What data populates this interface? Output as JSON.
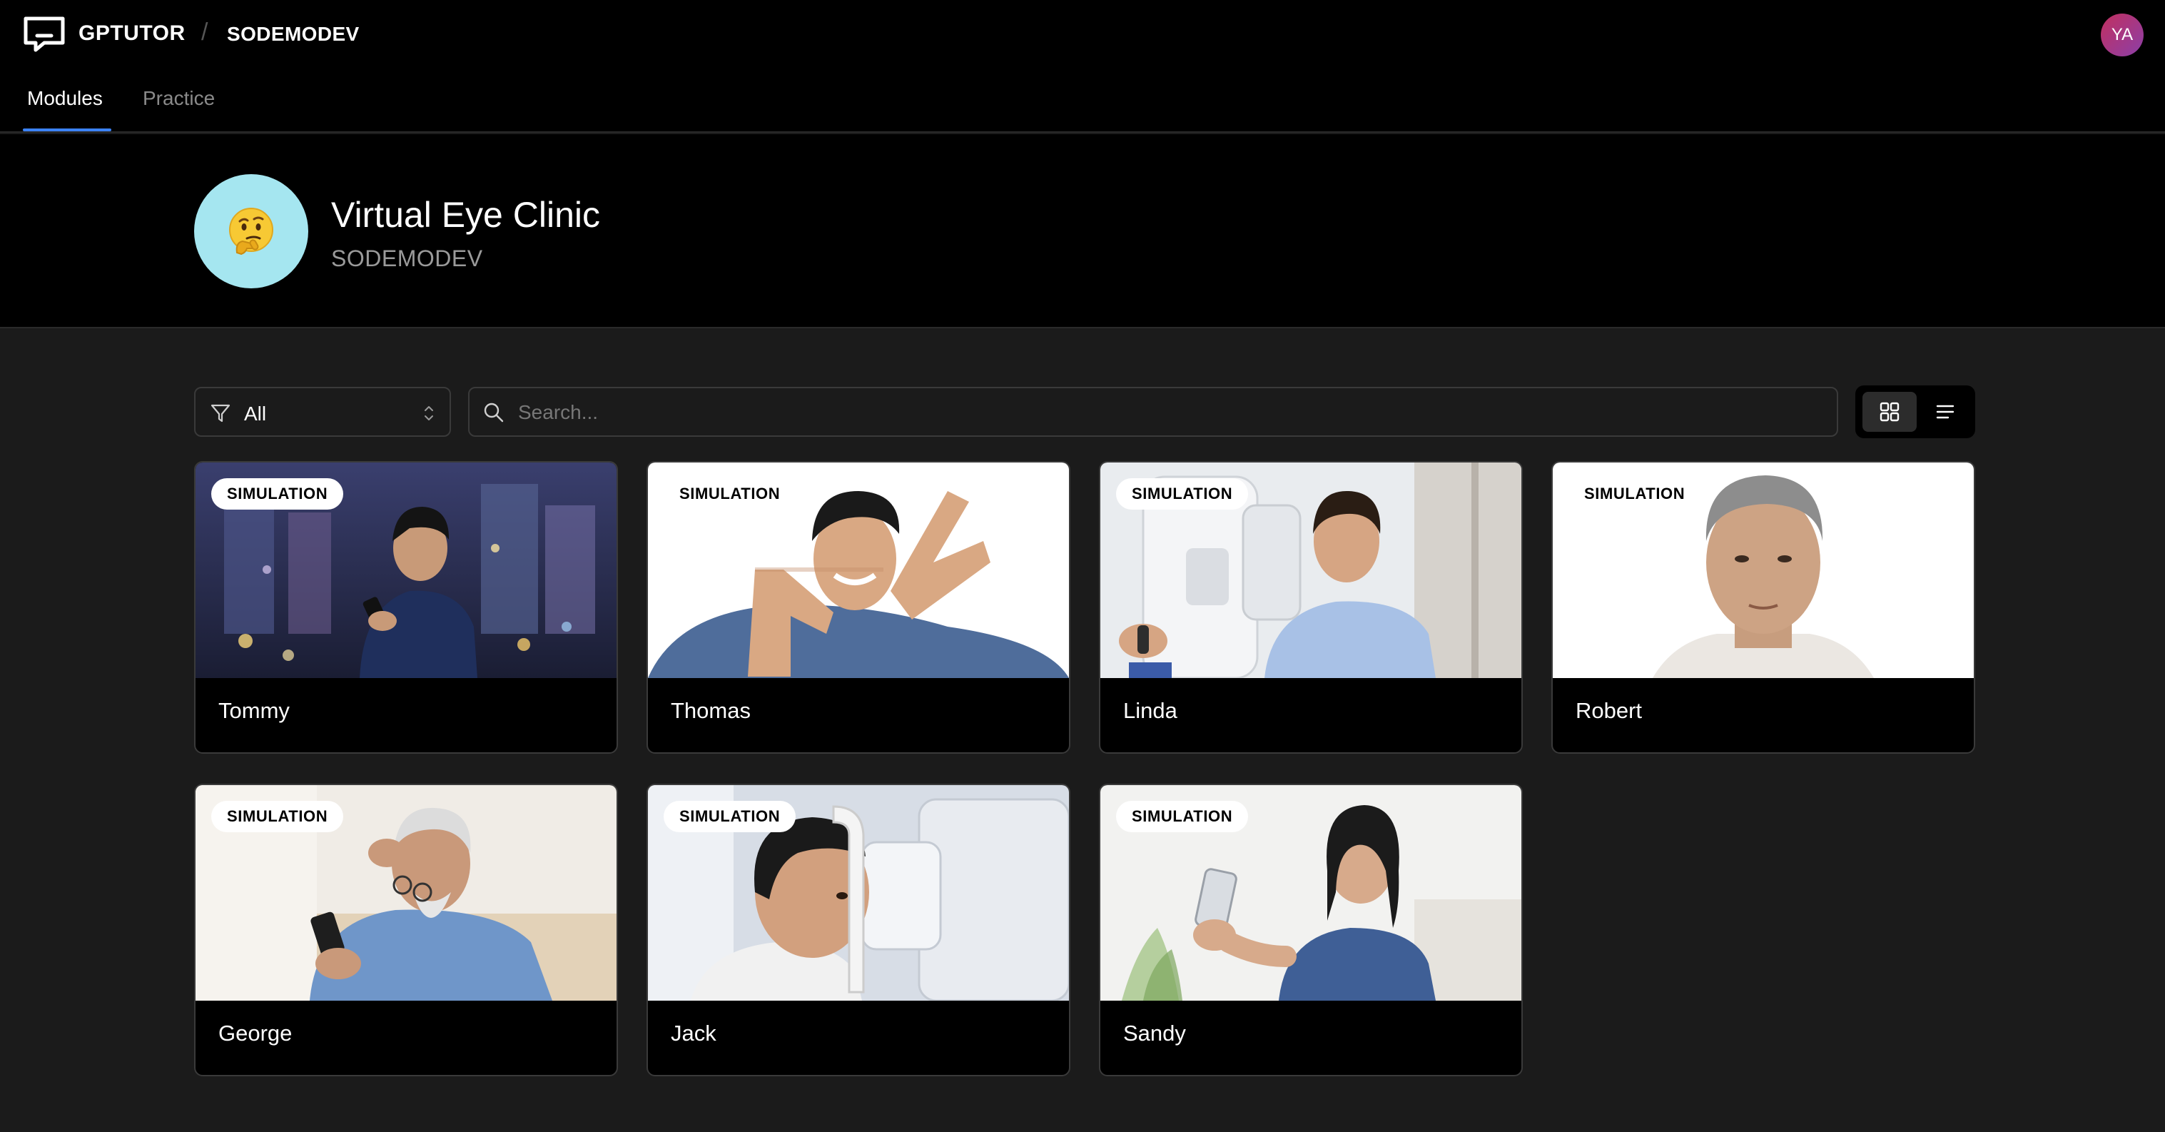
{
  "app": {
    "brand": "GPTUTOR",
    "separator": "/",
    "org": "SODEMODEV",
    "user_initials": "YA"
  },
  "tabs": [
    {
      "label": "Modules",
      "active": true
    },
    {
      "label": "Practice",
      "active": false
    }
  ],
  "module": {
    "title": "Virtual Eye Clinic",
    "subtitle": "SODEMODEV",
    "avatar_icon": "thinking-face-emoji",
    "avatar_color": "#a5e6f0"
  },
  "filter": {
    "value": "All"
  },
  "search": {
    "placeholder": "Search..."
  },
  "view": {
    "active": "grid"
  },
  "colors": {
    "accent": "#3b82f6",
    "avatar_gradient_start": "#c2305f",
    "avatar_gradient_end": "#8b3fa8"
  },
  "cards": [
    {
      "badge": "SIMULATION",
      "name": "Tommy"
    },
    {
      "badge": "SIMULATION",
      "name": "Thomas"
    },
    {
      "badge": "SIMULATION",
      "name": "Linda"
    },
    {
      "badge": "SIMULATION",
      "name": "Robert"
    },
    {
      "badge": "SIMULATION",
      "name": "George"
    },
    {
      "badge": "SIMULATION",
      "name": "Jack"
    },
    {
      "badge": "SIMULATION",
      "name": "Sandy"
    }
  ]
}
